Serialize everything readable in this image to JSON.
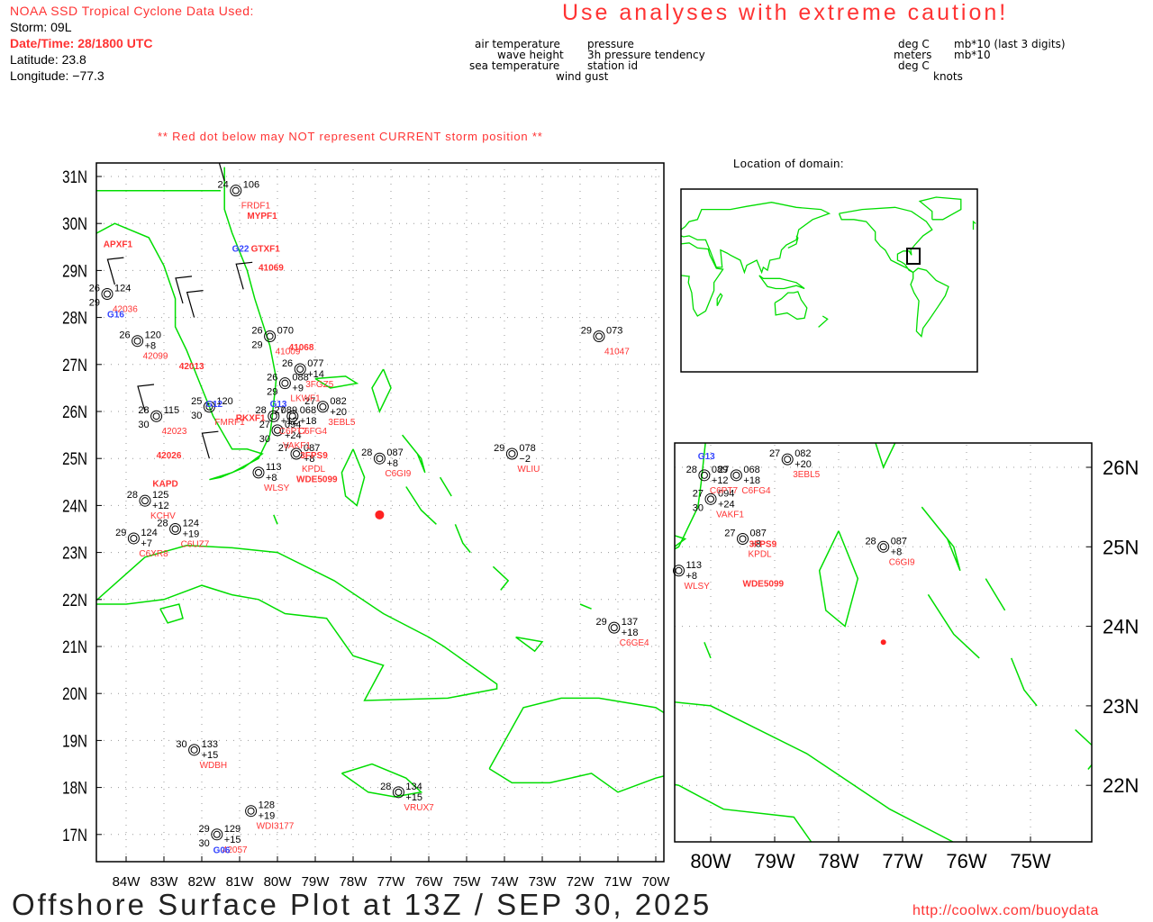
{
  "header": {
    "source_label": "NOAA SSD Tropical Cyclone Data Used:",
    "storm": "Storm: 09L",
    "datetime": "Date/Time: 28/1800 UTC",
    "latitude": "Latitude: 23.8",
    "longitude": "Longitude: −77.3",
    "caution": "Use analyses with extreme caution!"
  },
  "legend": {
    "left": {
      "air_temperature": "air temperature",
      "wave_height": "wave height",
      "sea_temperature": "sea temperature",
      "wind_gust": "wind gust",
      "pressure": "pressure",
      "tendency": "3h pressure tendency",
      "station_id": "station id"
    },
    "right": {
      "deg_c_1": "deg C",
      "meters": "meters",
      "deg_c_2": "deg C",
      "knots": "knots",
      "mb_last3": "mb*10 (last 3 digits)",
      "mb10": "mb*10"
    }
  },
  "notice": "** Red dot below may NOT represent CURRENT storm position **",
  "inset_title": "Location of domain:",
  "storm_position": {
    "lat": 23.8,
    "lon": -77.3
  },
  "main_map": {
    "lat_labels": [
      "31N",
      "30N",
      "29N",
      "28N",
      "27N",
      "26N",
      "25N",
      "24N",
      "23N",
      "22N",
      "21N",
      "20N",
      "19N",
      "18N",
      "17N"
    ],
    "lon_labels": [
      "84W",
      "83W",
      "82W",
      "81W",
      "80W",
      "79W",
      "78W",
      "77W",
      "76W",
      "75W",
      "74W",
      "73W",
      "72W",
      "71W",
      "70W"
    ]
  },
  "zoom_map": {
    "lat_labels": [
      "26N",
      "25N",
      "24N",
      "23N",
      "22N"
    ],
    "lon_labels": [
      "80W",
      "79W",
      "78W",
      "77W",
      "76W",
      "75W"
    ]
  },
  "stations": [
    {
      "id": "41047",
      "lon": -71.5,
      "lat": 27.6,
      "at": "29",
      "pres": "073"
    },
    {
      "id": "WLIU",
      "lon": -73.8,
      "lat": 25.1,
      "at": "29",
      "pres": "078",
      "tend": "−2"
    },
    {
      "id": "C6GI9",
      "lon": -77.3,
      "lat": 25.0,
      "at": "28",
      "pres": "087",
      "tend": "+8"
    },
    {
      "id": "C6GE4",
      "lon": -71.1,
      "lat": 21.4,
      "at": "29",
      "pres": "137",
      "tend": "+18"
    },
    {
      "id": "WDBH",
      "lon": -82.2,
      "lat": 18.8,
      "at": "30",
      "pres": "133",
      "tend": "+15"
    },
    {
      "id": "WDI3177",
      "lon": -80.7,
      "lat": 17.5,
      "pres": "128",
      "tend": "+19"
    },
    {
      "id": "VRUX7",
      "lon": -76.8,
      "lat": 17.9,
      "at": "28",
      "pres": "134",
      "tend": "+15"
    },
    {
      "id": "42057",
      "lon": -81.6,
      "lat": 17.0,
      "at": "29",
      "pres": "129",
      "tend": "+15",
      "sst": "30"
    },
    {
      "id": "KCHV",
      "lon": -83.5,
      "lat": 24.1,
      "at": "28",
      "pres": "125",
      "tend": "+12"
    },
    {
      "id": "C6UZ7",
      "lon": -82.7,
      "lat": 23.5,
      "at": "28",
      "pres": "124",
      "tend": "+19"
    },
    {
      "id": "C6XR8",
      "lon": -83.8,
      "lat": 23.3,
      "at": "29",
      "pres": "124",
      "tend": "+7"
    },
    {
      "id": "3FGZ5",
      "lon": -79.4,
      "lat": 26.9,
      "at": "26",
      "pres": "077",
      "tend": "+14"
    },
    {
      "id": "3EBL5",
      "lon": -78.8,
      "lat": 26.1,
      "at": "27",
      "pres": "082",
      "tend": "+20"
    },
    {
      "id": "41009",
      "lon": -80.2,
      "lat": 27.6,
      "at": "26",
      "pres": "070",
      "sst": "29"
    },
    {
      "id": "FRDF1",
      "lon": -81.1,
      "lat": 30.7,
      "at": "24",
      "pres": "106"
    },
    {
      "id": "42036",
      "lon": -84.5,
      "lat": 28.5,
      "at": "26",
      "pres": "124",
      "sst": "29"
    },
    {
      "id": "42099",
      "lon": -83.7,
      "lat": 27.5,
      "at": "26",
      "pres": "120",
      "tend": "+8"
    },
    {
      "id": "FMRF1",
      "lon": -81.8,
      "lat": 26.1,
      "at": "25",
      "pres": "120",
      "sst": "30"
    },
    {
      "id": "LKWF1",
      "lon": -79.8,
      "lat": 26.6,
      "at": "26",
      "pres": "088",
      "tend": "+9",
      "sst": "29"
    },
    {
      "id": "42023",
      "lon": -83.2,
      "lat": 25.9,
      "at": "28",
      "pres": "115",
      "sst": "30"
    },
    {
      "id": "KPDL",
      "lon": -79.5,
      "lat": 25.1,
      "at": "27",
      "pres": "087",
      "tend": "+8"
    },
    {
      "id": "WLSY",
      "lon": -80.5,
      "lat": 24.7,
      "pres": "113",
      "tend": "+8"
    },
    {
      "id": "C6FG4",
      "lon": -79.6,
      "lat": 25.9,
      "at": "27",
      "pres": "068",
      "tend": "+18"
    },
    {
      "id": "VAKF1",
      "lon": -80.0,
      "lat": 25.6,
      "at": "27",
      "pres": "094",
      "tend": "+24",
      "sst": "30"
    },
    {
      "id": "C6PT7",
      "lon": -80.1,
      "lat": 25.9,
      "at": "28",
      "pres": "089",
      "tend": "+12"
    }
  ],
  "extra_ids": [
    {
      "id": "APXF1",
      "lon": -84.6,
      "lat": 29.5,
      "color": "red"
    },
    {
      "id": "42013",
      "lon": -82.6,
      "lat": 26.9,
      "color": "red"
    },
    {
      "id": "42026",
      "lon": -83.2,
      "lat": 25.0,
      "color": "red"
    },
    {
      "id": "KAPD",
      "lon": -83.3,
      "lat": 24.4,
      "color": "red"
    },
    {
      "id": "41069",
      "lon": -80.5,
      "lat": 29.0,
      "color": "red"
    },
    {
      "id": "41068",
      "lon": -79.7,
      "lat": 27.3,
      "color": "red"
    },
    {
      "id": "GTXF1",
      "lon": -80.7,
      "lat": 29.4,
      "color": "red"
    },
    {
      "id": "MYPF1",
      "lon": -80.8,
      "lat": 30.1,
      "color": "red"
    },
    {
      "id": "RKXF1",
      "lon": -81.1,
      "lat": 25.8,
      "color": "red"
    },
    {
      "id": "WDE5099",
      "lon": -79.5,
      "lat": 24.5,
      "color": "red"
    },
    {
      "id": "3FPS9",
      "lon": -79.4,
      "lat": 25.0,
      "color": "red"
    },
    {
      "id": "G16",
      "lon": -84.5,
      "lat": 28.0,
      "color": "blue"
    },
    {
      "id": "G12",
      "lon": -81.9,
      "lat": 26.1,
      "color": "blue"
    },
    {
      "id": "G13",
      "lon": -80.2,
      "lat": 26.1,
      "color": "blue"
    },
    {
      "id": "G22",
      "lon": -81.2,
      "lat": 29.4,
      "color": "blue"
    },
    {
      "id": "G06",
      "lon": -81.7,
      "lat": 16.6,
      "color": "blue"
    }
  ],
  "footer": {
    "title": "Offshore Surface Plot at 13Z / SEP 30, 2025",
    "url": "http://coolwx.com/buoydata"
  },
  "colors": {
    "coast": "#00dd00",
    "label_red": "#ff3333",
    "label_blue": "#3344ff",
    "storm_dot": "#ff2222"
  }
}
